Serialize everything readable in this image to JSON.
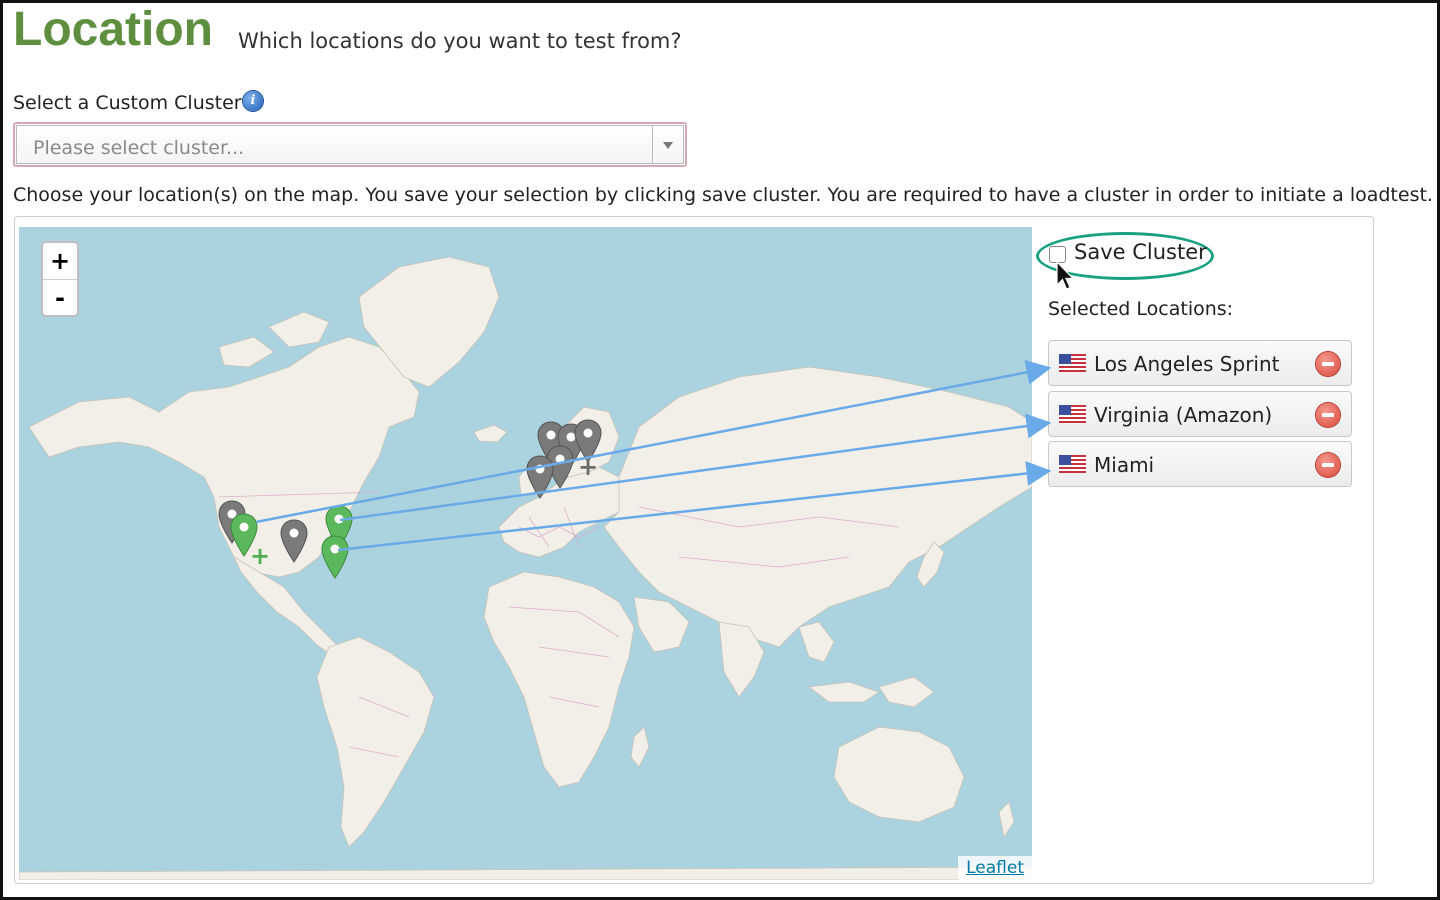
{
  "header": {
    "title": "Location",
    "subtitle": "Which locations do you want to test from?"
  },
  "cluster_select": {
    "label": "Select a Custom Cluster",
    "placeholder": "Please select cluster..."
  },
  "instructions": "Choose your location(s) on the map. You save your selection by clicking save cluster. You are required to have a cluster in order to initiate a loadtest.",
  "map": {
    "zoom_in": "+",
    "zoom_out": "-",
    "attribution": "Leaflet",
    "water_color": "#aad3df",
    "land_color": "#f2efe9",
    "border_color": "#d9a8c8",
    "selected_marker_color": "#5cb85c",
    "unselected_marker_color": "#7a7a7a"
  },
  "save_cluster": {
    "label": "Save Cluster",
    "checked": false,
    "highlight_color": "#1aa083"
  },
  "selected_locations": {
    "title": "Selected Locations:",
    "items": [
      {
        "label": "Los Angeles Sprint",
        "flag": "us-flag-icon"
      },
      {
        "label": "Virginia (Amazon)",
        "flag": "us-flag-icon"
      },
      {
        "label": "Miami",
        "flag": "us-flag-icon"
      }
    ]
  },
  "annotation_arrow_color": "#6aaae8"
}
